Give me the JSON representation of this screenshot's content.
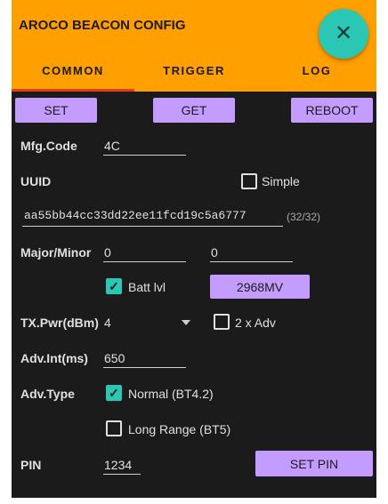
{
  "app": {
    "title": "AROCO BEACON CONFIG",
    "colors": {
      "header": "#ff9f00",
      "background": "#1b1b1b",
      "button": "#c49cff",
      "accent": "#29c7b4",
      "tab_indicator": "#e0401a"
    },
    "fab_icon": "close-icon",
    "fab_glyph": "✕"
  },
  "tabs": [
    {
      "label": "COMMON",
      "selected": true
    },
    {
      "label": "TRIGGER",
      "selected": false
    },
    {
      "label": "LOG",
      "selected": false
    }
  ],
  "actions": {
    "set": "SET",
    "get": "GET",
    "reboot": "REBOOT"
  },
  "form": {
    "mfg_code": {
      "label": "Mfg.Code",
      "value": "4C"
    },
    "uuid": {
      "label": "UUID",
      "simple_label": "Simple",
      "simple_checked": false,
      "value": "aa55bb44cc33dd22ee11fcd19c5a6777",
      "length_counter": "(32/32)"
    },
    "major_minor": {
      "label": "Major/Minor",
      "major": "0",
      "minor": "0"
    },
    "battery": {
      "label": "Batt lvl",
      "checked": true,
      "button": "2968MV"
    },
    "tx_power": {
      "label": "TX.Pwr(dBm)",
      "value": "4",
      "double_adv_label": "2 x Adv",
      "double_adv_checked": false
    },
    "adv_interval": {
      "label": "Adv.Int(ms)",
      "value": "650"
    },
    "adv_type": {
      "label": "Adv.Type",
      "normal_label": "Normal (BT4.2)",
      "normal_checked": true,
      "long_range_label": "Long Range (BT5)",
      "long_range_checked": false
    },
    "pin": {
      "label": "PIN",
      "value": "1234",
      "button": "SET PIN"
    }
  }
}
